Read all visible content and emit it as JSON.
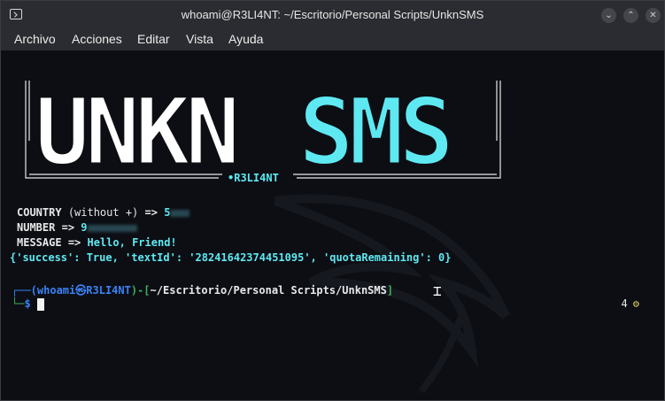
{
  "window": {
    "title": "whoami@R3LI4NT: ~/Escritorio/Personal Scripts/UnknSMS",
    "buttons": [
      "minimize-icon",
      "maximize-icon",
      "close-icon"
    ]
  },
  "menu": [
    "Archivo",
    "Acciones",
    "Editar",
    "Vista",
    "Ayuda"
  ],
  "banner": {
    "part1": "UNKN",
    "part2": "SMS",
    "author": "•R3LI4NT",
    "colors": {
      "part1": "#ffffff",
      "part2": "#5ee9f2",
      "frame": "#e8e8e8"
    }
  },
  "output": {
    "country_label": "COUNTRY",
    "country_hint": "(without +)",
    "country_arrow": "=>",
    "country_value": "5",
    "number_label": "NUMBER",
    "number_arrow": "=>",
    "number_value": "9",
    "message_label": "MESSAGE",
    "message_arrow": "=>",
    "message_value": "Hello, Friend!",
    "response": "{'success': True, 'textId': '28241642374451095', 'quotaRemaining': 0}"
  },
  "prompt": {
    "open": "┌──(",
    "user": "whoami",
    "at_symbol": "㉿",
    "host": "R3LI4NT",
    "mid": ")-[",
    "path": "~/Escritorio/Personal Scripts/UnknSMS",
    "close": "]",
    "second_line": "└─",
    "symbol": "$"
  },
  "status": {
    "jobs": "4",
    "icon": "gear-icon"
  },
  "colors": {
    "accent_cyan": "#5ee9f2",
    "prompt_blue": "#3b82f6",
    "terminal_bg": "#0c0e14",
    "titlebar_bg": "#2b2c31"
  }
}
